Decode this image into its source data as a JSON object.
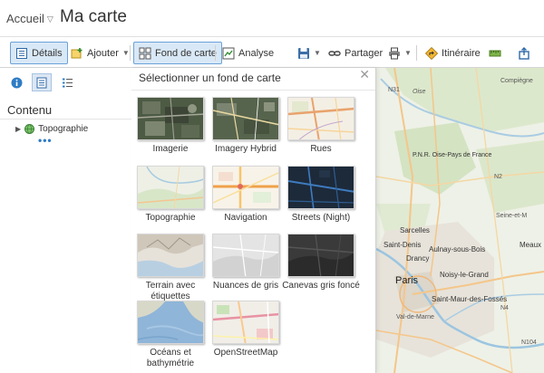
{
  "header": {
    "breadcrumb": "Accueil",
    "title": "Ma carte"
  },
  "toolbar": {
    "details": "Détails",
    "add": "Ajouter",
    "basemap": "Fond de carte",
    "analysis": "Analyse",
    "share": "Partager",
    "directions": "Itinéraire"
  },
  "left_panel": {
    "heading": "Contenu",
    "layers": [
      {
        "name": "Topographie"
      }
    ]
  },
  "basemap_gallery": {
    "title": "Sélectionner un fond de carte",
    "items": [
      {
        "label": "Imagerie"
      },
      {
        "label": "Imagery Hybrid"
      },
      {
        "label": "Rues"
      },
      {
        "label": "Topographie"
      },
      {
        "label": "Navigation"
      },
      {
        "label": "Streets (Night)"
      },
      {
        "label": "Terrain avec étiquettes"
      },
      {
        "label": "Nuances de gris"
      },
      {
        "label": "Canevas gris foncé"
      },
      {
        "label": "Océans et bathymétrie"
      },
      {
        "label": "OpenStreetMap"
      }
    ]
  },
  "map": {
    "labels": {
      "compiegne": "Compiègne",
      "n31": "N31",
      "oise": "Oise",
      "pnr": "P.N.R. Oise-Pays de France",
      "seine_et_marne": "Seine-et-M",
      "sarcelles": "Sarcelles",
      "saint_denis": "Saint-Denis",
      "aulnay": "Aulnay-sous-Bois",
      "drancy": "Drancy",
      "noisy": "Noisy-le-Grand",
      "paris": "Paris",
      "saint_maur": "Saint-Maur-des-Fossés",
      "val_de_marne": "Val-de-Marne",
      "meaux": "Meaux",
      "n2": "N2",
      "n4": "N4",
      "n104": "N104"
    }
  },
  "colors": {
    "accent": "#2f7cc4",
    "active_bg": "#d9e8f6"
  }
}
